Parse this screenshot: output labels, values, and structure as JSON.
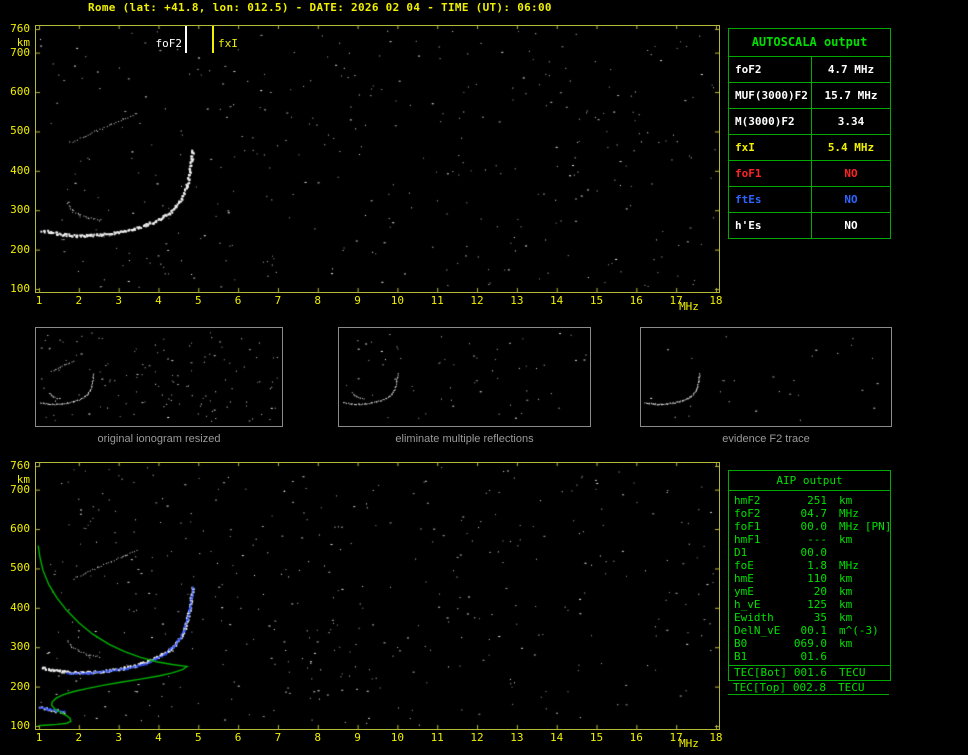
{
  "header": {
    "title": "Rome (lat: +41.8, lon: 012.5) - DATE: 2026 02 04 - TIME (UT): 06:00"
  },
  "axes": {
    "x_ticks": [
      1,
      2,
      3,
      4,
      5,
      6,
      7,
      8,
      9,
      10,
      11,
      12,
      13,
      14,
      15,
      16,
      17,
      18
    ],
    "x_unit": "MHz",
    "y_ticks": [
      760,
      700,
      600,
      500,
      400,
      300,
      200,
      100
    ],
    "y_unit": "km"
  },
  "top_markers": {
    "fof2_label": "foF2",
    "fxi_label": "fxI"
  },
  "autoscala": {
    "title": "AUTOSCALA output",
    "rows": [
      {
        "label": "foF2",
        "value": "4.7 MHz",
        "color": "#ffffff"
      },
      {
        "label": "MUF(3000)F2",
        "value": "15.7 MHz",
        "color": "#ffffff"
      },
      {
        "label": "M(3000)F2",
        "value": "3.34",
        "color": "#ffffff"
      },
      {
        "label": "fxI",
        "value": "5.4 MHz",
        "color": "#f0f000"
      },
      {
        "label": "foF1",
        "value": "NO",
        "color": "#ff2424"
      },
      {
        "label": "ftEs",
        "value": "NO",
        "color": "#2e64ff"
      },
      {
        "label": "h'Es",
        "value": "NO",
        "color": "#ffffff"
      }
    ]
  },
  "thumbnails": [
    {
      "caption": "original ionogram resized"
    },
    {
      "caption": "eliminate multiple reflections"
    },
    {
      "caption": "evidence F2 trace"
    }
  ],
  "aip": {
    "title": "AIP output",
    "rows": [
      {
        "label": "hmF2",
        "value": "251",
        "unit": "km"
      },
      {
        "label": "foF2",
        "value": "04.7",
        "unit": "MHz"
      },
      {
        "label": "foF1",
        "value": "00.0",
        "unit": "MHz",
        "extra": "[PN]"
      },
      {
        "label": "hmF1",
        "value": "---",
        "unit": "km"
      },
      {
        "label": "D1",
        "value": "00.0",
        "unit": ""
      },
      {
        "label": "foE",
        "value": "1.8",
        "unit": "MHz"
      },
      {
        "label": "hmE",
        "value": "110",
        "unit": "km"
      },
      {
        "label": "ymE",
        "value": "20",
        "unit": "km"
      },
      {
        "label": "h_vE",
        "value": "125",
        "unit": "km"
      },
      {
        "label": "Ewidth",
        "value": "35",
        "unit": "km"
      },
      {
        "label": "DelN_vE",
        "value": "00.1",
        "unit": "m^(-3)"
      },
      {
        "label": "B0",
        "value": "069.0",
        "unit": "km"
      },
      {
        "label": "B1",
        "value": "01.6",
        "unit": ""
      }
    ],
    "tec_rows": [
      {
        "label": "TEC[Bot]",
        "value": "001.6",
        "unit": "TECU"
      },
      {
        "label": "TEC[Top]",
        "value": "002.8",
        "unit": "TECU"
      }
    ]
  },
  "colors": {
    "axis_yellow": "#f0f000",
    "frame_yellow": "#b8b838",
    "table_border_green": "#00aa00",
    "table_text_green": "#00e000",
    "profile_green": "#00b400",
    "trace_blue": "#3355ff",
    "trace_white": "#f0f0f0",
    "caption_gray": "#9a9a9a"
  },
  "ionogram_traces": {
    "f_trace": [
      [
        1.05,
        250
      ],
      [
        1.3,
        245
      ],
      [
        1.6,
        240
      ],
      [
        1.9,
        237
      ],
      [
        2.2,
        237
      ],
      [
        2.6,
        240
      ],
      [
        3.0,
        246
      ],
      [
        3.4,
        255
      ],
      [
        3.7,
        265
      ],
      [
        4.0,
        278
      ],
      [
        4.25,
        294
      ],
      [
        4.45,
        313
      ],
      [
        4.6,
        336
      ],
      [
        4.7,
        365
      ],
      [
        4.77,
        400
      ],
      [
        4.82,
        432
      ],
      [
        4.85,
        455
      ]
    ],
    "left_hook": [
      [
        1.7,
        318
      ],
      [
        1.82,
        302
      ],
      [
        2.0,
        290
      ],
      [
        2.25,
        281
      ],
      [
        2.5,
        276
      ]
    ],
    "hop2_trace": [
      [
        1.85,
        475
      ],
      [
        2.15,
        489
      ],
      [
        2.45,
        503
      ],
      [
        2.8,
        518
      ],
      [
        3.1,
        532
      ],
      [
        3.45,
        547
      ]
    ],
    "restored_trace_blue": [
      [
        1.7,
        236
      ],
      [
        2.2,
        236
      ],
      [
        2.7,
        241
      ],
      [
        3.2,
        248
      ],
      [
        3.6,
        258
      ],
      [
        3.9,
        270
      ],
      [
        4.15,
        285
      ],
      [
        4.35,
        303
      ],
      [
        4.5,
        322
      ],
      [
        4.62,
        345
      ],
      [
        4.7,
        372
      ],
      [
        4.77,
        402
      ],
      [
        4.82,
        430
      ],
      [
        4.85,
        452
      ]
    ],
    "e_trace_blue": [
      [
        1.0,
        150
      ],
      [
        1.2,
        145
      ],
      [
        1.4,
        141
      ],
      [
        1.6,
        138
      ]
    ],
    "profile_green": [
      [
        0.98,
        558
      ],
      [
        1.02,
        530
      ],
      [
        1.1,
        495
      ],
      [
        1.25,
        458
      ],
      [
        1.45,
        425
      ],
      [
        1.7,
        393
      ],
      [
        2.0,
        362
      ],
      [
        2.35,
        333
      ],
      [
        2.75,
        308
      ],
      [
        3.15,
        289
      ],
      [
        3.55,
        274
      ],
      [
        3.95,
        263
      ],
      [
        4.35,
        256
      ],
      [
        4.65,
        252
      ],
      [
        4.72,
        251
      ],
      [
        4.6,
        243
      ],
      [
        4.35,
        235
      ],
      [
        4.0,
        227
      ],
      [
        3.55,
        219
      ],
      [
        3.05,
        211
      ],
      [
        2.6,
        203
      ],
      [
        2.2,
        195
      ],
      [
        1.85,
        187
      ],
      [
        1.6,
        179
      ],
      [
        1.42,
        170
      ],
      [
        1.33,
        161
      ],
      [
        1.32,
        152
      ],
      [
        1.4,
        143
      ],
      [
        1.55,
        134
      ],
      [
        1.7,
        126
      ],
      [
        1.78,
        119
      ],
      [
        1.8,
        112
      ],
      [
        1.7,
        107
      ],
      [
        1.45,
        104
      ],
      [
        1.15,
        102
      ],
      [
        0.98,
        101
      ]
    ]
  }
}
